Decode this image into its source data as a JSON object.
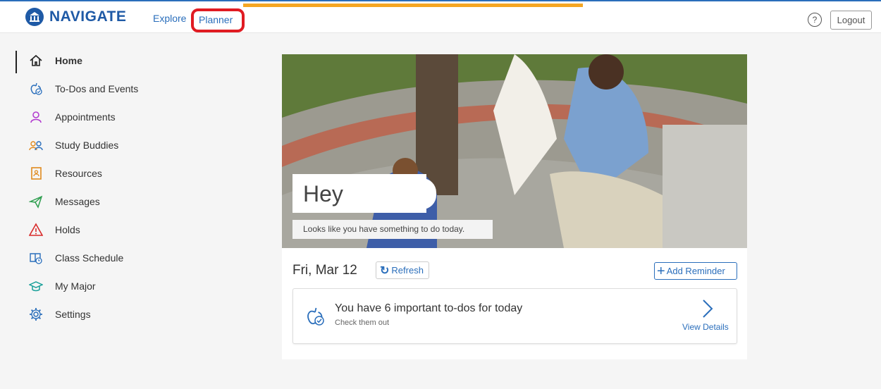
{
  "header": {
    "brand": "NAVIGATE",
    "nav": [
      {
        "label": "Explore"
      },
      {
        "label": "Planner"
      }
    ],
    "help_label": "?",
    "logout_label": "Logout"
  },
  "sidebar": {
    "items": [
      {
        "label": "Home",
        "icon": "home-icon"
      },
      {
        "label": "To-Dos and Events",
        "icon": "apple-check-icon"
      },
      {
        "label": "Appointments",
        "icon": "person-icon"
      },
      {
        "label": "Study Buddies",
        "icon": "people-icon"
      },
      {
        "label": "Resources",
        "icon": "resource-book-icon"
      },
      {
        "label": "Messages",
        "icon": "paper-plane-icon"
      },
      {
        "label": "Holds",
        "icon": "warning-icon"
      },
      {
        "label": "Class Schedule",
        "icon": "schedule-book-icon"
      },
      {
        "label": "My Major",
        "icon": "graduation-cap-icon"
      },
      {
        "label": "Settings",
        "icon": "gear-icon"
      }
    ]
  },
  "hero": {
    "greeting": "Hey",
    "subtitle": "Looks like you have something to do today."
  },
  "today": {
    "date": "Fri, Mar 12",
    "refresh_label": "Refresh",
    "add_reminder_label": "Add Reminder"
  },
  "todo": {
    "title": "You have 6 important to-dos for today",
    "subtitle": "Check them out",
    "view_details": "View Details"
  },
  "colors": {
    "brand": "#1f5aa6",
    "link": "#2a6ebb",
    "highlight": "#e01b22",
    "progress": "#f5a623"
  }
}
